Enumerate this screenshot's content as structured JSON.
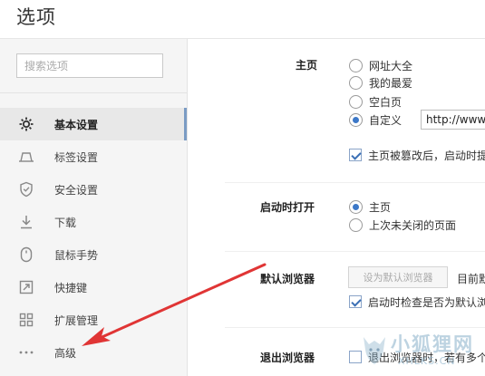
{
  "header": {
    "title": "选项"
  },
  "sidebar": {
    "search_placeholder": "搜索选项",
    "items": [
      {
        "label": "基本设置",
        "icon": "gear-icon",
        "active": true
      },
      {
        "label": "标签设置",
        "icon": "tab-icon",
        "active": false
      },
      {
        "label": "安全设置",
        "icon": "shield-icon",
        "active": false
      },
      {
        "label": "下载",
        "icon": "download-icon",
        "active": false
      },
      {
        "label": "鼠标手势",
        "icon": "mouse-icon",
        "active": false
      },
      {
        "label": "快捷键",
        "icon": "shortcut-icon",
        "active": false
      },
      {
        "label": "扩展管理",
        "icon": "extensions-icon",
        "active": false
      },
      {
        "label": "高级",
        "icon": "more-icon",
        "active": false
      }
    ]
  },
  "homepage": {
    "label": "主页",
    "options": [
      "网址大全",
      "我的最爱",
      "空白页",
      "自定义"
    ],
    "selected": "自定义",
    "url_value": "http://www",
    "protect_text": "主页被篡改后，启动时提"
  },
  "startup": {
    "label": "启动时打开",
    "options": [
      "主页",
      "上次未关闭的页面"
    ],
    "selected": "主页"
  },
  "default_browser": {
    "label": "默认浏览器",
    "button_label": "设为默认浏览器",
    "status_text": "目前默",
    "check_text": "启动时检查是否为默认浏"
  },
  "exit_browser": {
    "label": "退出浏览器",
    "check_text": "退出浏览器时，若有多个"
  },
  "watermark": {
    "cn": "小狐狸网",
    "en": "XHLKS.CN"
  },
  "colors": {
    "accent": "#3c78c8",
    "arrow": "#e03535",
    "active_bar": "#7a9bc4"
  }
}
